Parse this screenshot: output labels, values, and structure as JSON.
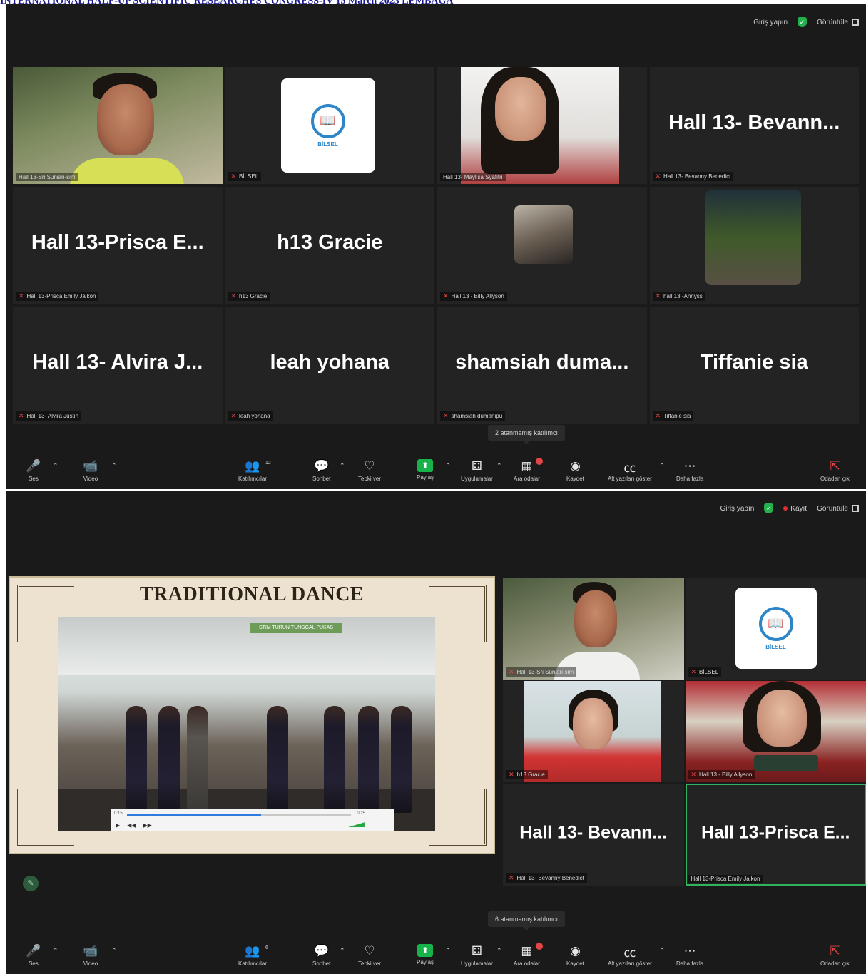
{
  "page_banner": "INTERNATIONAL HALF-UP SCIENTIFIC RESEARCHES CONGRESS-IV 15 March 2023 LEMBAGA",
  "screenshots": [
    {
      "topbar": {
        "login": "Giriş yapın",
        "view": "Görüntüle"
      },
      "tiles": [
        {
          "kind": "video",
          "label": "Hall 13-Sri Suniari-sim",
          "active": true
        },
        {
          "kind": "logo",
          "label": "BİLSEL",
          "logo_text": "BİLSEL"
        },
        {
          "kind": "video",
          "label": "Hall 13- Maylisa Syafitri"
        },
        {
          "kind": "name",
          "name": "Hall 13- Bevann...",
          "label": "Hall 13- Bevanny Benedict"
        },
        {
          "kind": "name",
          "name": "Hall 13-Prisca E...",
          "label": "Hall 13-Prisca Emily Jaikon"
        },
        {
          "kind": "name",
          "name": "h13 Gracie",
          "label": "h13 Gracie"
        },
        {
          "kind": "avatar",
          "label": "Hall 13 - Billy Allyson"
        },
        {
          "kind": "avatar2",
          "label": "hall 13 -Annyss"
        },
        {
          "kind": "name",
          "name": "Hall 13- Alvira J...",
          "label": "Hall 13- Alvira Justin"
        },
        {
          "kind": "name",
          "name": "leah yohana",
          "label": "leah yohana"
        },
        {
          "kind": "name",
          "name": "shamsiah duma...",
          "label": "shamsiah dumanipu"
        },
        {
          "kind": "name",
          "name": "Tiffanie sia",
          "label": "Tiffanie sia"
        }
      ],
      "popover": "2 atanmamış katılımcı",
      "participants_count": "12"
    },
    {
      "topbar": {
        "login": "Giriş yapın",
        "record": "Kayıt",
        "view": "Görüntüle"
      },
      "share": {
        "title": "TRADITIONAL DANCE",
        "sign": "STIM TURUN TUNGGAL PUKAS"
      },
      "tiles": [
        {
          "kind": "video",
          "label": "Hall 13-Sri Suniari-sim"
        },
        {
          "kind": "logo",
          "label": "BİLSEL",
          "logo_text": "BİLSEL"
        },
        {
          "kind": "video",
          "label": "h13 Gracie"
        },
        {
          "kind": "video",
          "label": "Hall 13 - Billy Allyson"
        },
        {
          "kind": "name",
          "name": "Hall 13- Bevann...",
          "label": "Hall 13- Bevanny Benedict"
        },
        {
          "kind": "name",
          "name": "Hall 13-Prisca E...",
          "label": "Hall 13-Prisca Emily Jaikon",
          "active": true
        }
      ],
      "popover": "6 atanmamış katılımcı",
      "participants_count": "6",
      "player_progress": 0.6
    }
  ],
  "toolbar": {
    "mic": "Ses",
    "video": "Video",
    "participants": "Katılımcılar",
    "chat": "Sohbet",
    "react": "Tepki ver",
    "share": "Paylaş",
    "apps": "Uygulamalar",
    "breakout": "Ara odalar",
    "record": "Kaydet",
    "captions": "Alt yazıları göster",
    "more": "Daha fazla",
    "leave": "Odadan çık"
  }
}
